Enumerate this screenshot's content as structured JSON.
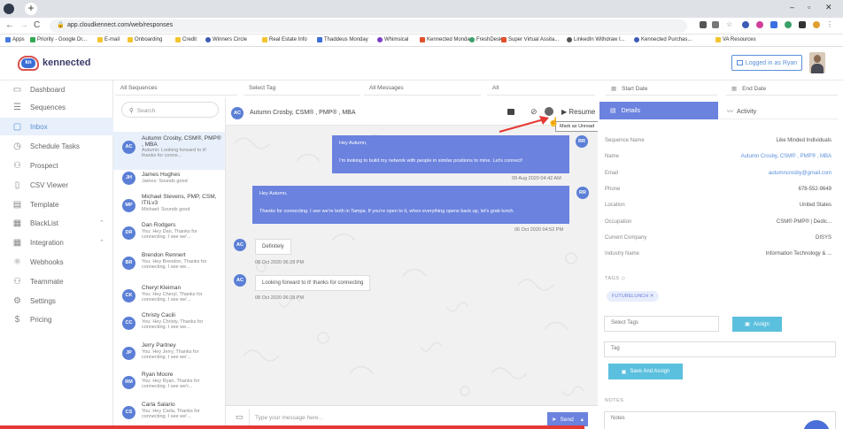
{
  "browser": {
    "url": "app.cloudkennect.com/web/responses",
    "bookmarks": [
      "Apps",
      "Priority - Google Dr...",
      "E-mail",
      "Onboarding",
      "Credit",
      "Winners Circle",
      "Real Estate Info",
      "Thaddeus Monday",
      "Whimsical",
      "Kennected Monday",
      "FreshDesk",
      "Super Virtual Assita...",
      "LinkedIn Withdraw I...",
      "Kennected Purchas...",
      "VA Resources"
    ]
  },
  "header": {
    "logo_badge": "kn",
    "logo_text": "kennected",
    "logged_in": "Logged in as Ryan"
  },
  "sidebar": {
    "items": [
      {
        "label": "Dashboard",
        "icon": "monitor-icon"
      },
      {
        "label": "Sequences",
        "icon": "list-icon"
      },
      {
        "label": "Inbox",
        "icon": "chat-icon"
      },
      {
        "label": "Schedule Tasks",
        "icon": "clock-icon"
      },
      {
        "label": "Prospect",
        "icon": "users-icon"
      },
      {
        "label": "CSV Viewer",
        "icon": "file-icon"
      },
      {
        "label": "Template",
        "icon": "template-icon"
      },
      {
        "label": "BlackList",
        "icon": "block-list-icon"
      },
      {
        "label": "Integration",
        "icon": "integration-icon"
      },
      {
        "label": "Webhooks",
        "icon": "webhook-icon"
      },
      {
        "label": "Teammate",
        "icon": "teammate-icon"
      },
      {
        "label": "Settings",
        "icon": "gear-icon"
      },
      {
        "label": "Pricing",
        "icon": "dollar-icon"
      }
    ]
  },
  "filters": {
    "sequences": "All Sequences",
    "tag": "Select Tag",
    "messages": "All Messages",
    "all": "All",
    "start_date": "Start Date",
    "end_date": "End Date"
  },
  "search": {
    "placeholder": "Search"
  },
  "conversations": [
    {
      "initials": "AC",
      "name": "Autumn Crosby, CSM®, PMP® , MBA",
      "preview": "Autumn: Looking forward to it! thanks for conne..."
    },
    {
      "initials": "JH",
      "name": "James Hughes",
      "preview": "James: Sounds good"
    },
    {
      "initials": "MP",
      "name": "Michael Stevens, PMP, CSM, ITILv3",
      "preview": "Michael: Sounds good"
    },
    {
      "initials": "DR",
      "name": "Dan Rodgers",
      "preview": "You: Hey Dan, Thanks for connecting. I see we'..."
    },
    {
      "initials": "BR",
      "name": "Brendon Rennert",
      "preview": "You: Hey Brendon, Thanks for connecting. I see we..."
    },
    {
      "initials": "CK",
      "name": "Cheryl Kleiman",
      "preview": "You: Hey Cheryl, Thanks for connecting. I see we'..."
    },
    {
      "initials": "CC",
      "name": "Christy Cacili",
      "preview": "You: Hey Christy, Thanks for connecting. I see we..."
    },
    {
      "initials": "JP",
      "name": "Jerry Partney",
      "preview": "You: Hey Jerry, Thanks for connecting. I see we'..."
    },
    {
      "initials": "RM",
      "name": "Ryan Moore",
      "preview": "You: Hey Ryan, Thanks for connecting. I see we'r..."
    },
    {
      "initials": "CS",
      "name": "Carla Salario",
      "preview": "You: Hey Carla, Thanks for connecting. I see we'..."
    }
  ],
  "chat": {
    "contact_initials": "AC",
    "contact_name": "Autumn Crosby, CSM® , PMP® , MBA",
    "resume_label": "Resume",
    "tooltip": "Mark as Unread",
    "messages": [
      {
        "from": "RR",
        "greeting": "Hey Autumn,",
        "body": "I'm looking to build my network with people in similar positions to mine. Let's connect!",
        "time": "09 Aug 2020 04:42 AM"
      },
      {
        "from": "RR",
        "greeting": "Hey Autumn,",
        "body": "Thanks for connecting. I see we're both in Tampa. If you're open to it, when everything opens back up, let's grab lunch.",
        "time": "06 Oct 2020 04:52 PM"
      },
      {
        "from": "AC",
        "body": "Definitely",
        "time": "08 Oct 2020 06:28 PM"
      },
      {
        "from": "AC",
        "body": "Looking forward to it! thanks for connecting",
        "time": "08 Oct 2020 06:28 PM"
      }
    ],
    "composer_placeholder": "Type your message here...",
    "send_label": "Send"
  },
  "details": {
    "tab_details": "Details",
    "tab_activity": "Activity",
    "rows": [
      {
        "label": "Sequence Name",
        "value": "Like Minded Individuals"
      },
      {
        "label": "Name",
        "value": "Autumn Crosby, CSM® , PMP® , MBA"
      },
      {
        "label": "Email",
        "value": "autumncrosby@gmail.com"
      },
      {
        "label": "Phone",
        "value": "678-552-9649"
      },
      {
        "label": "Location",
        "value": "United States"
      },
      {
        "label": "Occupation",
        "value": "CSM® PMP® | Dedic..."
      },
      {
        "label": "Current Company",
        "value": "DISYS"
      },
      {
        "label": "Industry Name",
        "value": "Information Technology & ..."
      }
    ],
    "tags_label": "TAGS",
    "tag": "FUTURELUNCH",
    "select_tags_placeholder": "Select Tags",
    "assign_label": "Assign",
    "tag_input_placeholder": "Tag",
    "save_assign_label": "Save And Assign",
    "notes_label": "NOTES",
    "notes_placeholder": "Notes"
  },
  "colors": {
    "accent": "#6b82de",
    "sidebar_active": "#e8f0fb",
    "assign": "#5bc0de",
    "red_arrow": "#e53935"
  }
}
